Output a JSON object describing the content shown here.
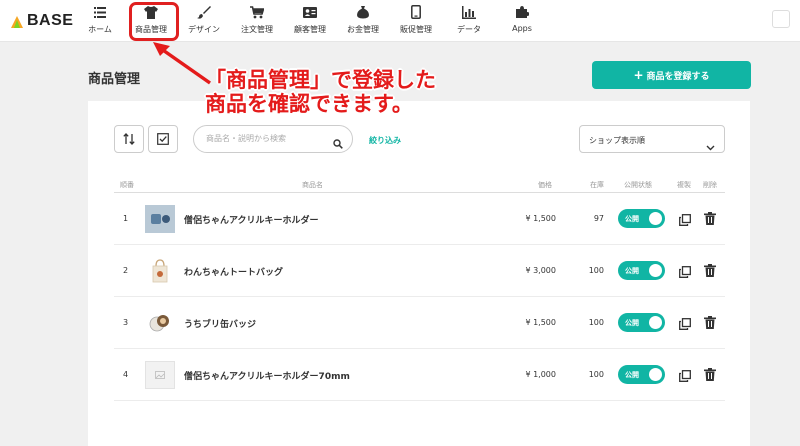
{
  "brand": {
    "name": "BASE"
  },
  "nav": {
    "items": [
      {
        "label": "ホーム",
        "icon": "list-icon"
      },
      {
        "label": "商品管理",
        "icon": "shirt-icon"
      },
      {
        "label": "デザイン",
        "icon": "brush-icon"
      },
      {
        "label": "注文管理",
        "icon": "cart-icon"
      },
      {
        "label": "顧客管理",
        "icon": "customer-icon"
      },
      {
        "label": "お金管理",
        "icon": "money-bag-icon"
      },
      {
        "label": "販促管理",
        "icon": "phone-icon"
      },
      {
        "label": "データ",
        "icon": "bar-chart-icon"
      },
      {
        "label": "Apps",
        "icon": "puzzle-icon"
      }
    ]
  },
  "annotation": {
    "line1": "「商品管理」で登録した",
    "line2": "商品を確認できます。",
    "color": "#e41b1b"
  },
  "page": {
    "title": "商品管理",
    "register_button": "商品を登録する"
  },
  "toolbar": {
    "search_placeholder": "商品名・説明から検索",
    "filter_label": "絞り込み",
    "sort_value": "ショップ表示順"
  },
  "table": {
    "headers": {
      "num": "順番",
      "name": "商品名",
      "price": "価格",
      "stock": "在庫",
      "status": "公開状態",
      "copy": "複製",
      "delete": "削除"
    },
    "rows": [
      {
        "num": "1",
        "name": "僧侶ちゃんアクリルキーホルダー",
        "price": "¥ 1,500",
        "stock": "97",
        "status": "公開",
        "thumb": "keychain-thumb"
      },
      {
        "num": "2",
        "name": "わんちゃんトートバッグ",
        "price": "¥ 3,000",
        "stock": "100",
        "status": "公開",
        "thumb": "tote-bag-thumb"
      },
      {
        "num": "3",
        "name": "うちブリ缶バッジ",
        "price": "¥ 1,500",
        "stock": "100",
        "status": "公開",
        "thumb": "badge-thumb"
      },
      {
        "num": "4",
        "name": "僧侶ちゃんアクリルキーホルダー70mm",
        "price": "¥ 1,000",
        "stock": "100",
        "status": "公開",
        "thumb": "placeholder-thumb"
      }
    ]
  },
  "colors": {
    "accent": "#11b5a4",
    "highlight": "#e02020"
  }
}
